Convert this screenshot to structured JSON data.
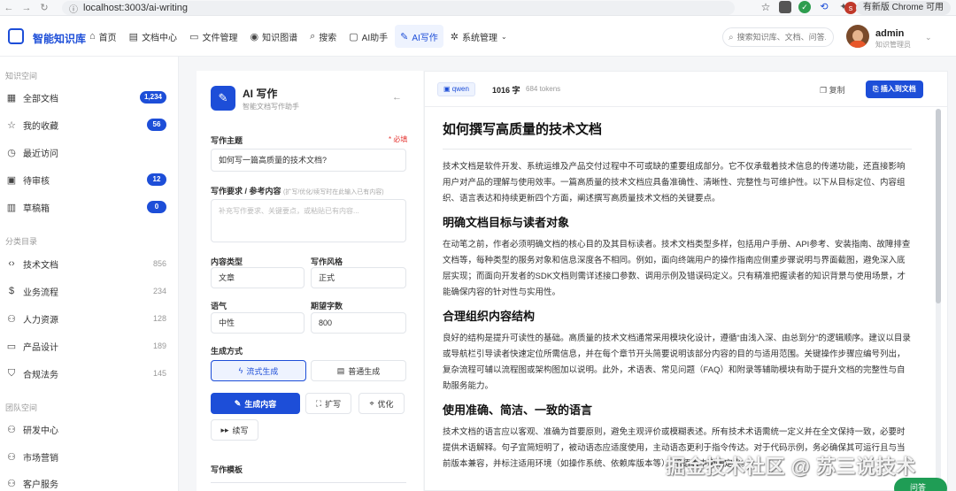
{
  "browser": {
    "url": "localhost:3003/ai-writing",
    "update_label": "有新版 Chrome 可用",
    "profile_initial": "s"
  },
  "header": {
    "app_name": "智能知识库",
    "nav": [
      {
        "label": "首页",
        "icon": "home-icon"
      },
      {
        "label": "文档中心",
        "icon": "doc-icon"
      },
      {
        "label": "文件管理",
        "icon": "folder-icon"
      },
      {
        "label": "知识图谱",
        "icon": "graph-icon"
      },
      {
        "label": "搜索",
        "icon": "search-icon"
      },
      {
        "label": "AI助手",
        "icon": "chat-icon"
      },
      {
        "label": "AI写作",
        "icon": "pen-icon",
        "active": true
      },
      {
        "label": "系统管理",
        "icon": "gear-icon"
      }
    ],
    "search_placeholder": "搜索知识库、文档、问答...",
    "user_name": "admin",
    "user_role": "知识管理员"
  },
  "sidebar": {
    "section1": "知识空间",
    "items1": [
      {
        "label": "全部文档",
        "badge": "1,234"
      },
      {
        "label": "我的收藏",
        "badge": "56"
      },
      {
        "label": "最近访问"
      },
      {
        "label": "待审核",
        "badge": "12"
      },
      {
        "label": "草稿箱",
        "badge": "0"
      }
    ],
    "section2": "分类目录",
    "items2": [
      {
        "label": "技术文档",
        "count": "856"
      },
      {
        "label": "业务流程",
        "count": "234"
      },
      {
        "label": "人力资源",
        "count": "128"
      },
      {
        "label": "产品设计",
        "count": "189"
      },
      {
        "label": "合规法务",
        "count": "145"
      }
    ],
    "section3": "团队空间",
    "items3": [
      {
        "label": "研发中心"
      },
      {
        "label": "市场营销"
      },
      {
        "label": "客户服务"
      }
    ]
  },
  "form": {
    "title": "AI 写作",
    "subtitle": "智能文档写作助手",
    "topic_label": "写作主题",
    "required": "* 必填",
    "topic_value": "如何写一篇高质量的技术文档?",
    "req_label": "写作要求 / 参考内容",
    "req_hint": "(扩写/优化/续写时在此输入已有内容)",
    "req_placeholder": "补充写作要求、关键要点，或粘贴已有内容...",
    "content_type_label": "内容类型",
    "content_type_value": "文章",
    "style_label": "写作风格",
    "style_value": "正式",
    "tone_label": "语气",
    "tone_value": "中性",
    "words_label": "期望字数",
    "words_value": "800",
    "mode_label": "生成方式",
    "mode_stream": "流式生成",
    "mode_normal": "普通生成",
    "btn_generate": "生成内容",
    "btn_expand": "扩写",
    "btn_optimize": "优化",
    "btn_continue": "续写",
    "template_label": "写作模板"
  },
  "editor": {
    "model": "qwen",
    "word_count": "1016 字",
    "tokens": "684 tokens",
    "copy_label": "复制",
    "insert_label": "插入到文档",
    "doc_title": "如何撰写高质量的技术文档",
    "intro": "技术文档是软件开发、系统运维及产品交付过程中不可或缺的重要组成部分。它不仅承载着技术信息的传递功能，还直接影响用户对产品的理解与使用效率。一篇高质量的技术文档应具备准确性、清晰性、完整性与可维护性。以下从目标定位、内容组织、语言表达和持续更新四个方面，阐述撰写高质量技术文档的关键要点。",
    "h2_1": "明确文档目标与读者对象",
    "p1": "在动笔之前，作者必须明确文档的核心目的及其目标读者。技术文档类型多样，包括用户手册、API参考、安装指南、故障排查文档等，每种类型的服务对象和信息深度各不相同。例如，面向终端用户的操作指南应侧重步骤说明与界面截图，避免深入底层实现；而面向开发者的SDK文档则需详述接口参数、调用示例及错误码定义。只有精准把握读者的知识背景与使用场景，才能确保内容的针对性与实用性。",
    "h2_2": "合理组织内容结构",
    "p2": "良好的结构是提升可读性的基础。高质量的技术文档通常采用模块化设计，遵循“由浅入深、由总到分”的逻辑顺序。建议以目录或导航栏引导读者快速定位所需信息，并在每个章节开头简要说明该部分内容的目的与适用范围。关键操作步骤应编号列出，复杂流程可辅以流程图或架构图加以说明。此外，术语表、常见问题（FAQ）和附录等辅助模块有助于提升文档的完整性与自助服务能力。",
    "h2_3": "使用准确、简洁、一致的语言",
    "p3": "技术文档的语言应以客观、准确为首要原则，避免主观评价或模糊表述。所有技术术语需统一定义并在全文保持一致，必要时提供术语解释。句子宜简短明了，被动语态应适度使用，主动语态更利于指令传达。对于代码示例，务必确保其可运行且与当前版本兼容，并标注适用环境（如操作系统、依赖库版本等）。术语表中明确定义。",
    "watermark": "掘金技术社区 @ 苏三说技术",
    "float_label": "问答"
  }
}
